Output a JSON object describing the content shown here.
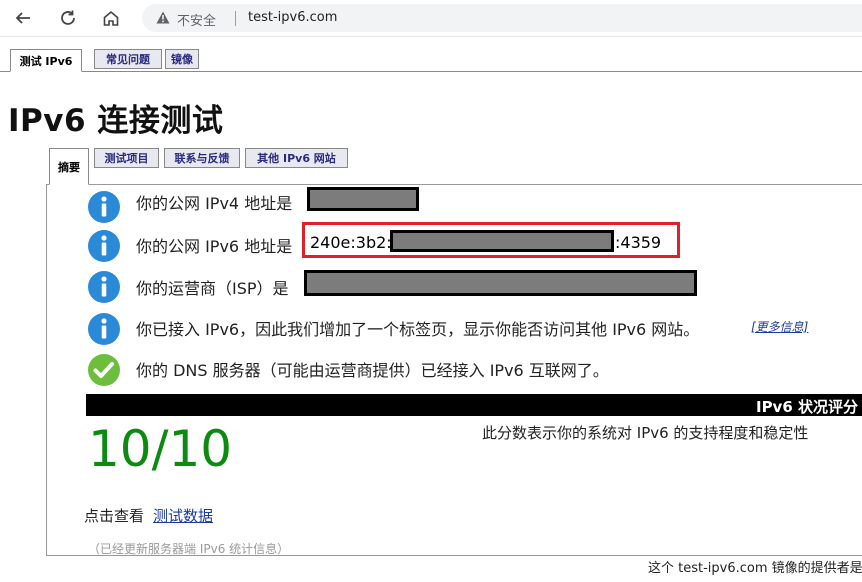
{
  "browser": {
    "insecure_label": "不安全",
    "url": "test-ipv6.com"
  },
  "top_tabs": [
    {
      "label": "测试 IPv6"
    },
    {
      "label": "常见问题"
    },
    {
      "label": "镜像"
    }
  ],
  "page_title": "IPv6 连接测试",
  "inner_tabs": [
    {
      "label": "摘要"
    },
    {
      "label": "测试项目"
    },
    {
      "label": "联系与反馈"
    },
    {
      "label": "其他 IPv6 网站"
    }
  ],
  "results": [
    {
      "icon": "info-icon",
      "text": "你的公网 IPv4 地址是"
    },
    {
      "icon": "info-icon",
      "text": "你的公网 IPv6 地址是"
    },
    {
      "icon": "info-icon",
      "text": "你的运营商（ISP）是"
    },
    {
      "icon": "info-icon",
      "text": "你已接入 IPv6，因此我们增加了一个标签页，显示你能否访问其他 IPv6 网站。"
    },
    {
      "icon": "check-icon",
      "text": "你的 DNS 服务器（可能由运营商提供）已经接入 IPv6 互联网了。"
    }
  ],
  "ipv6_prefix": "240e:3b2:",
  "ipv6_suffix": ":4359",
  "more_info_link": "[更多信息]",
  "score_section": {
    "label": "IPv6 状况评分",
    "score": "10/10",
    "description": "此分数表示你的系统对 IPv6 的支持程度和稳定性"
  },
  "click_view": "点击查看",
  "test_data_link": "测试数据",
  "stats_note": "（已经更新服务器端 IPv6 统计信息）",
  "footer_note": "这个 test-ipv6.com 镜像的提供者是",
  "colors": {
    "info_blue": "#2a8ad8",
    "check_green": "#6cbe3c",
    "score_green": "#0e8a12",
    "highlight_red": "#e0202c",
    "link_blue": "#1a3aa0"
  }
}
